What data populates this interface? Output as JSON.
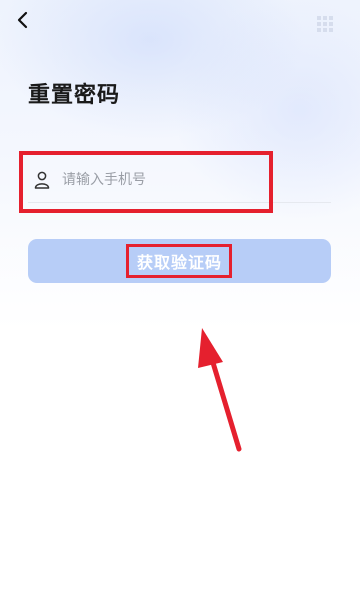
{
  "header": {
    "back_icon": "chevron-left-icon",
    "corner_icon": "grid-icon"
  },
  "page": {
    "title": "重置密码"
  },
  "form": {
    "phone_icon": "user-icon",
    "phone_placeholder": "请输入手机号",
    "phone_value": "",
    "submit_label": "获取验证码"
  },
  "annotations": {
    "highlight_color": "#e5202e",
    "arrow_color": "#e5202e"
  },
  "colors": {
    "button_bg": "#b7cdf7",
    "title_text": "#1a1a1a",
    "placeholder": "#9a9ea6"
  }
}
